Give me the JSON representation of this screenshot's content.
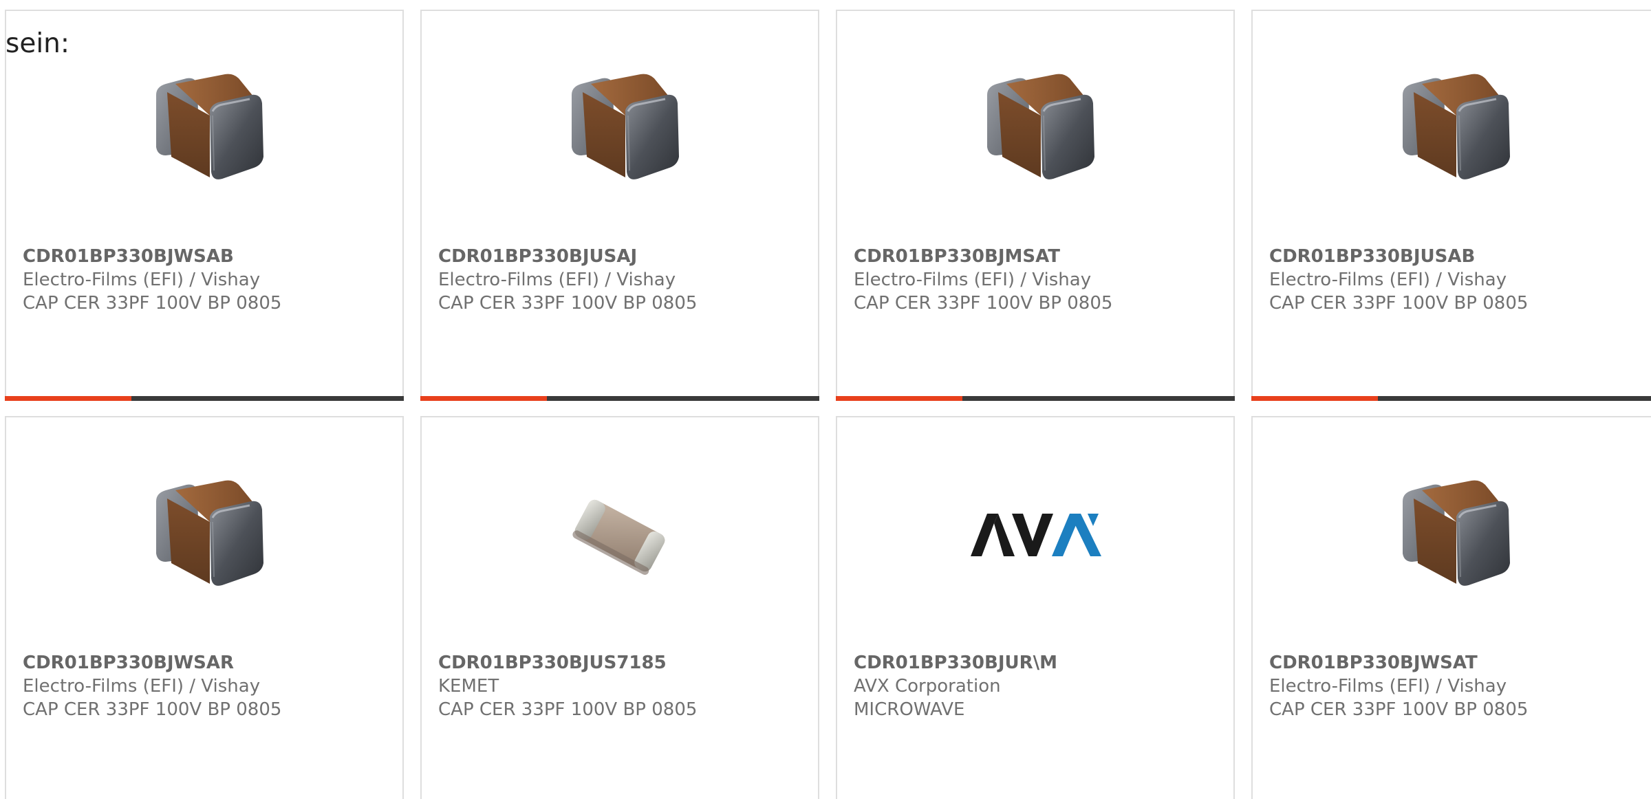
{
  "heading": "sein:",
  "colors": {
    "accent": "#e8401c",
    "bar": "#3a3a3a",
    "card_border": "#dedede",
    "avx_dark": "#1a1a1a",
    "avx_blue": "#1c7fc0"
  },
  "products": [
    {
      "part_number": "CDR01BP330BJWSAB",
      "manufacturer": "Electro-Films (EFI) / Vishay",
      "description": "CAP CER 33PF 100V BP 0805",
      "image": "mlcc-capacitor-image"
    },
    {
      "part_number": "CDR01BP330BJUSAJ",
      "manufacturer": "Electro-Films (EFI) / Vishay",
      "description": "CAP CER 33PF 100V BP 0805",
      "image": "mlcc-capacitor-image"
    },
    {
      "part_number": "CDR01BP330BJMSAT",
      "manufacturer": "Electro-Films (EFI) / Vishay",
      "description": "CAP CER 33PF 100V BP 0805",
      "image": "mlcc-capacitor-image"
    },
    {
      "part_number": "CDR01BP330BJUSAB",
      "manufacturer": "Electro-Films (EFI) / Vishay",
      "description": "CAP CER 33PF 100V BP 0805",
      "image": "mlcc-capacitor-image"
    },
    {
      "part_number": "CDR01BP330BJWSAR",
      "manufacturer": "Electro-Films (EFI) / Vishay",
      "description": "CAP CER 33PF 100V BP 0805",
      "image": "mlcc-capacitor-image"
    },
    {
      "part_number": "CDR01BP330BJUS7185",
      "manufacturer": "KEMET",
      "description": "CAP CER 33PF 100V BP 0805",
      "image": "small-chip-capacitor-image"
    },
    {
      "part_number": "CDR01BP330BJUR\\M",
      "manufacturer": "AVX Corporation",
      "description": "MICROWAVE",
      "image": "avx-logo",
      "logo_text": "AVX"
    },
    {
      "part_number": "CDR01BP330BJWSAT",
      "manufacturer": "Electro-Films (EFI) / Vishay",
      "description": "CAP CER 33PF 100V BP 0805",
      "image": "mlcc-capacitor-image"
    }
  ]
}
